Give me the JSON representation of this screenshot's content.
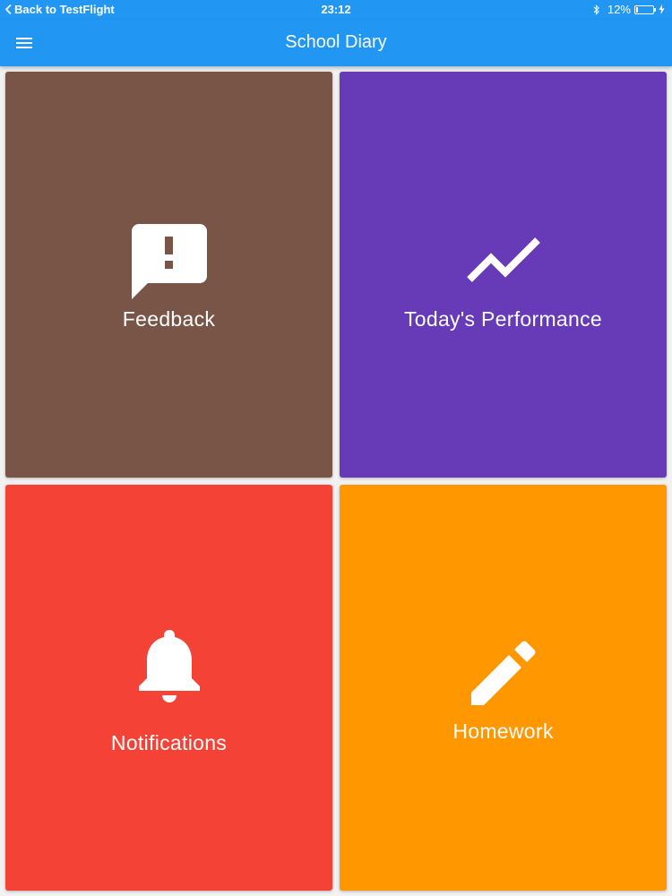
{
  "status_bar": {
    "back_label": "Back to TestFlight",
    "time": "23:12",
    "battery_percent": "12%",
    "battery_level": 0.12,
    "icons": [
      "back-chevron-icon",
      "bluetooth-icon",
      "battery-icon",
      "charging-bolt-icon"
    ]
  },
  "app_bar": {
    "title": "School Diary",
    "menu_icon": "hamburger-menu-icon",
    "color": "#2196f3"
  },
  "tiles": [
    {
      "label": "Feedback",
      "icon": "feedback-alert-icon",
      "color": "#795548"
    },
    {
      "label": "Today's Performance",
      "icon": "trending-up-icon",
      "color": "#673ab7"
    },
    {
      "label": "Notifications",
      "icon": "bell-icon",
      "color": "#f44336"
    },
    {
      "label": "Homework",
      "icon": "pencil-icon",
      "color": "#ff9800"
    }
  ]
}
